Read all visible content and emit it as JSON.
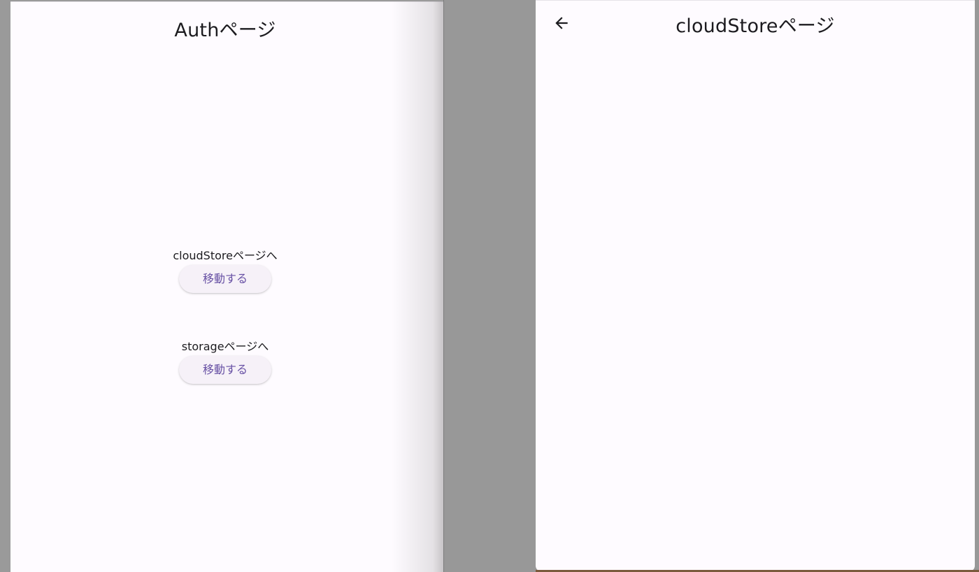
{
  "auth_page": {
    "title": "Authページ",
    "nav_items": [
      {
        "label": "cloudStoreページへ",
        "button_label": "移動する"
      },
      {
        "label": "storageページへ",
        "button_label": "移動する"
      }
    ]
  },
  "cloudstore_page": {
    "title": "cloudStoreページ",
    "back_icon": "arrow-back-icon"
  },
  "colors": {
    "surface": "#fefbff",
    "on_surface": "#1c1b1f",
    "primary": "#6750a4",
    "button_container": "#f6f1f8",
    "scrim": "#9a9a9a"
  }
}
